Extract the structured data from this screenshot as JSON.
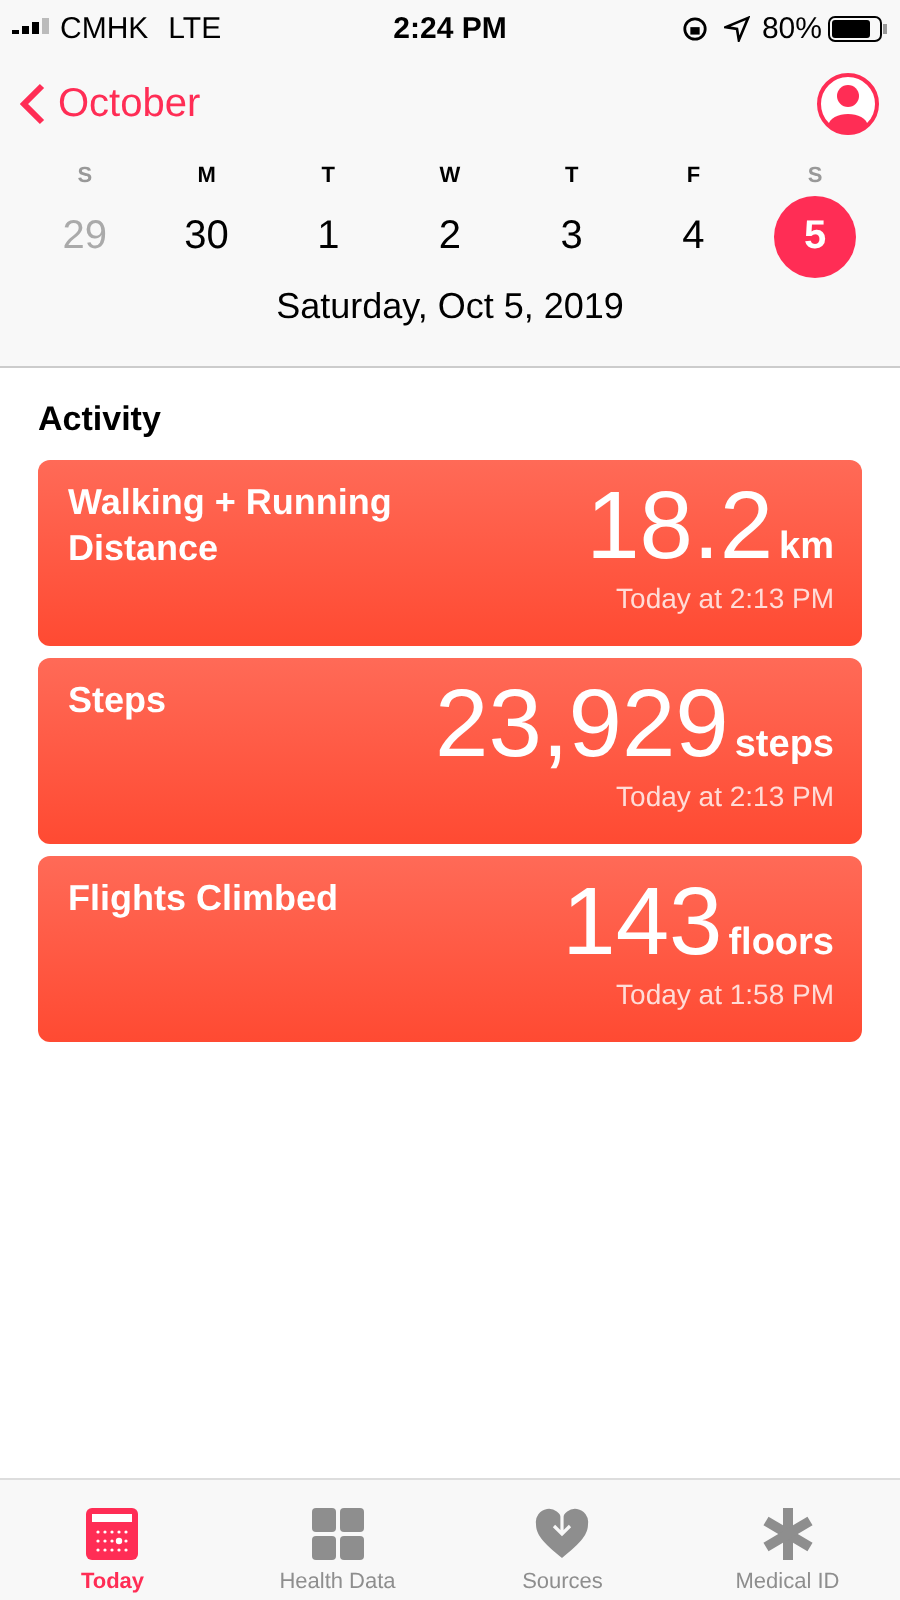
{
  "status_bar": {
    "carrier": "CMHK",
    "network": "LTE",
    "time": "2:24 PM",
    "battery": "80%"
  },
  "nav": {
    "back_label": "October"
  },
  "weekdays": [
    {
      "letter": "S",
      "weekend": true
    },
    {
      "letter": "M",
      "weekend": false
    },
    {
      "letter": "T",
      "weekend": false
    },
    {
      "letter": "W",
      "weekend": false
    },
    {
      "letter": "T",
      "weekend": false
    },
    {
      "letter": "F",
      "weekend": false
    },
    {
      "letter": "S",
      "weekend": true
    }
  ],
  "dates": [
    {
      "label": "29",
      "selected": false,
      "other_month": true
    },
    {
      "label": "30",
      "selected": false,
      "other_month": false
    },
    {
      "label": "1",
      "selected": false,
      "other_month": false
    },
    {
      "label": "2",
      "selected": false,
      "other_month": false
    },
    {
      "label": "3",
      "selected": false,
      "other_month": false
    },
    {
      "label": "4",
      "selected": false,
      "other_month": false
    },
    {
      "label": "5",
      "selected": true,
      "other_month": false
    }
  ],
  "selected_date": "Saturday, Oct 5, 2019",
  "section_title": "Activity",
  "cards": [
    {
      "title": "Walking + Running Distance",
      "value": "18.2",
      "unit": "km",
      "time": "Today at 2:13 PM"
    },
    {
      "title": "Steps",
      "value": "23,929",
      "unit": "steps",
      "time": "Today at 2:13 PM"
    },
    {
      "title": "Flights Climbed",
      "value": "143",
      "unit": "floors",
      "time": "Today at 1:58 PM"
    }
  ],
  "tabs": [
    {
      "label": "Today",
      "kind": "calendar",
      "selected": true
    },
    {
      "label": "Health Data",
      "kind": "grid",
      "selected": false
    },
    {
      "label": "Sources",
      "kind": "heart",
      "selected": false
    },
    {
      "label": "Medical ID",
      "kind": "asterisk",
      "selected": false
    }
  ]
}
